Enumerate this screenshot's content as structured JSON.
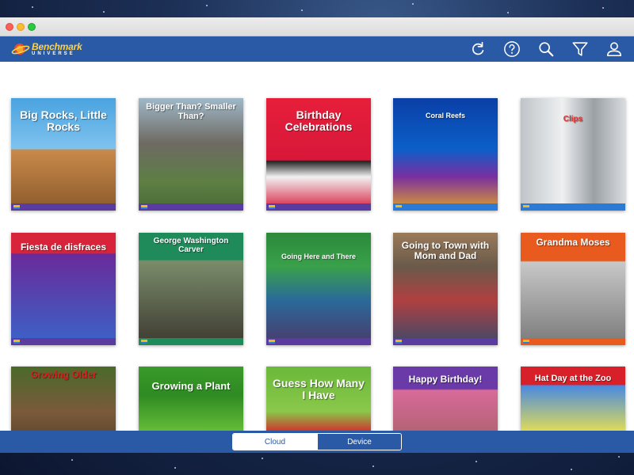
{
  "app": {
    "logo_line1": "Benchmark",
    "logo_line2": "UNIVERSE"
  },
  "toolbar": {
    "icons": [
      "refresh-icon",
      "help-icon",
      "search-icon",
      "filter-icon",
      "user-icon"
    ]
  },
  "books": [
    {
      "title": "Big Rocks, Little Rocks",
      "theme": "rocks"
    },
    {
      "title": "Bigger Than? Smaller Than?",
      "theme": "elephants"
    },
    {
      "title": "Birthday Celebrations",
      "theme": "dog"
    },
    {
      "title": "Coral Reefs",
      "theme": "reef"
    },
    {
      "title": "Clips",
      "theme": "clips"
    },
    {
      "title": "Fiesta de disfraces",
      "theme": "fiesta"
    },
    {
      "title": "George Washington Carver",
      "theme": "carver"
    },
    {
      "title": "Going Here and There",
      "theme": "bike"
    },
    {
      "title": "Going to Town with Mom and Dad",
      "theme": "family"
    },
    {
      "title": "Grandma Moses",
      "theme": "grandma"
    },
    {
      "title": "Growing Older",
      "theme": "older"
    },
    {
      "title": "Growing a Plant",
      "theme": "plant"
    },
    {
      "title": "Guess How Many I Have",
      "theme": "berries"
    },
    {
      "title": "Happy Birthday!",
      "theme": "party"
    },
    {
      "title": "Hat Day at the Zoo",
      "theme": "zoo"
    }
  ],
  "bottom_tabs": {
    "cloud": "Cloud",
    "device": "Device",
    "active": "Cloud"
  },
  "colors": {
    "appbar": "#2a5aa6",
    "accent_yellow": "#ffd23f"
  }
}
